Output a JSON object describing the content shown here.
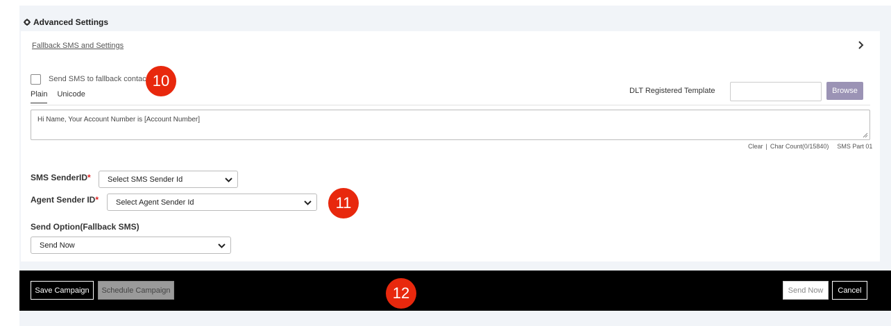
{
  "advanced_settings": {
    "title": "Advanced Settings",
    "fallback_link": "Fallback SMS and Settings",
    "checkbox_label": "Send SMS to fallback contact",
    "tabs": [
      "Plain",
      "Unicode"
    ],
    "dlt_label": "DLT Registered Template",
    "dlt_value": "",
    "browse_label": "Browse",
    "message": "Hi Name, Your Account Number is [Account Number]",
    "clear_label": "Clear",
    "separator": "|",
    "char_count": "Char Count(0/15840)",
    "sms_part": "SMS Part 01",
    "sender_id_label": "SMS SenderID",
    "sender_id_value": "Select SMS Sender Id",
    "agent_sender_label": "Agent Sender ID",
    "agent_sender_value": "Select Agent Sender Id",
    "required_mark": "*",
    "send_option_label": "Send Option(Fallback SMS)",
    "send_option_value": "Send Now"
  },
  "footer": {
    "save_label": "Save Campaign",
    "schedule_label": "Schedule Campaign",
    "send_now_label": "Send Now",
    "cancel_label": "Cancel"
  },
  "annotations": [
    "10",
    "11",
    "12"
  ],
  "colors": {
    "badge": "#e8280d",
    "browse": "#9b93b5",
    "footer": "#000000",
    "page_bg": "#f1f4f8"
  }
}
